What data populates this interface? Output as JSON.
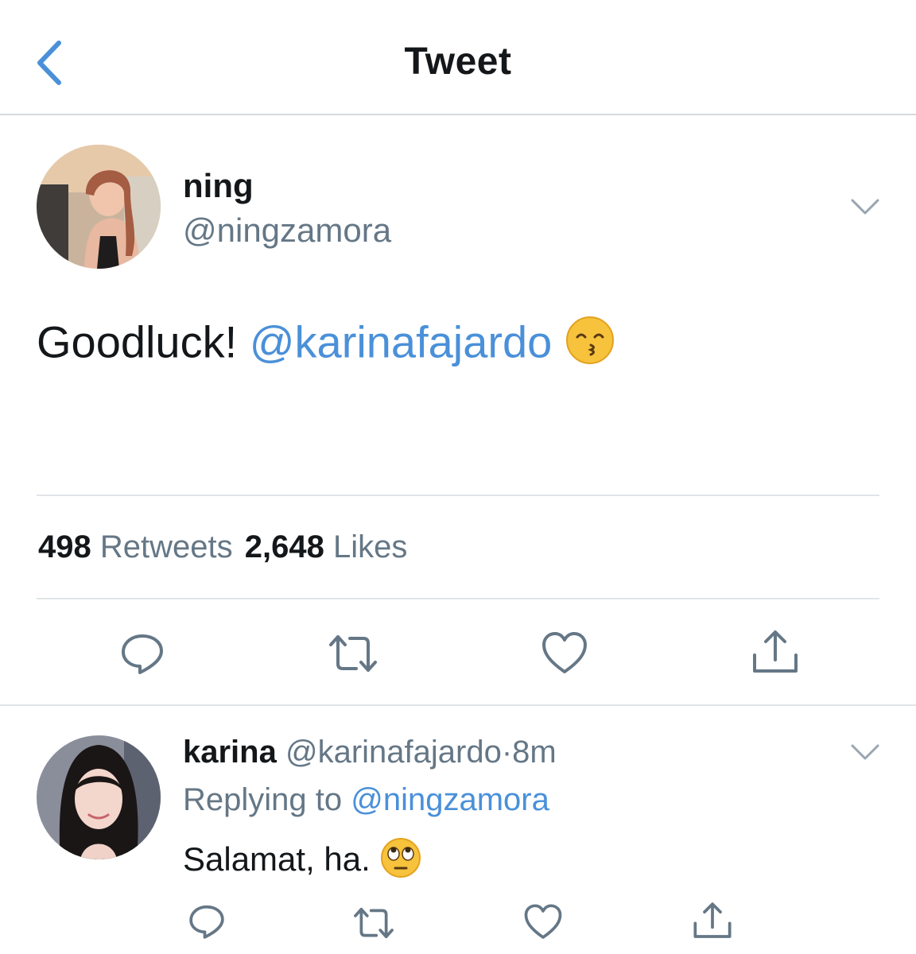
{
  "header": {
    "title": "Tweet",
    "back_icon": "chevron-left-icon"
  },
  "colors": {
    "accent": "#4a90d9",
    "secondary_text": "#657786",
    "divider": "#e1e5e8"
  },
  "tweet": {
    "name": "ning",
    "handle": "@ningzamora",
    "text": "Goodluck!",
    "mention": "@karinafajardo",
    "emoji": "kissing-face-with-smiling-eyes",
    "stats": {
      "retweets_count": "498",
      "retweets_label": "Retweets",
      "likes_count": "2,648",
      "likes_label": "Likes"
    },
    "actions": [
      "reply-icon",
      "retweet-icon",
      "like-icon",
      "share-icon"
    ]
  },
  "reply": {
    "name": "karina",
    "handle": "@karinafajardo",
    "separator": "·",
    "time": "8m",
    "replying_to_label": "Replying to",
    "replying_to_handle": "@ningzamora",
    "text": "Salamat, ha.",
    "emoji": "face-with-rolling-eyes",
    "actions": [
      "reply-icon",
      "retweet-icon",
      "like-icon",
      "share-icon"
    ]
  }
}
